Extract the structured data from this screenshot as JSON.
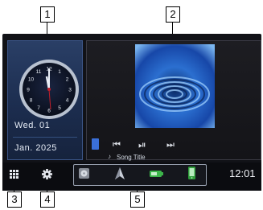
{
  "callouts": [
    "1",
    "2",
    "3",
    "4",
    "5"
  ],
  "clock_widget": {
    "day": "Wed.   01",
    "month_year": "Jan.  2025",
    "hour_numerals": [
      "12",
      "1",
      "2",
      "3",
      "4",
      "5",
      "6",
      "7",
      "8",
      "9",
      "10",
      "11"
    ]
  },
  "media": {
    "song_title": "Song Title",
    "icons": [
      "source-icon",
      "previous-track-icon",
      "play-pause-icon",
      "next-track-icon",
      "music-note-icon"
    ]
  },
  "bottom_bar": {
    "time": "12:01",
    "icons": [
      "menu-grid-icon",
      "settings-gear-icon"
    ],
    "dock_icons": [
      "disc-icon",
      "navigation-arrow-icon",
      "battery-icon",
      "phone-icon"
    ]
  },
  "colors": {
    "accent_blue": "#2a3f66",
    "second_hand": "#c41f2a"
  }
}
